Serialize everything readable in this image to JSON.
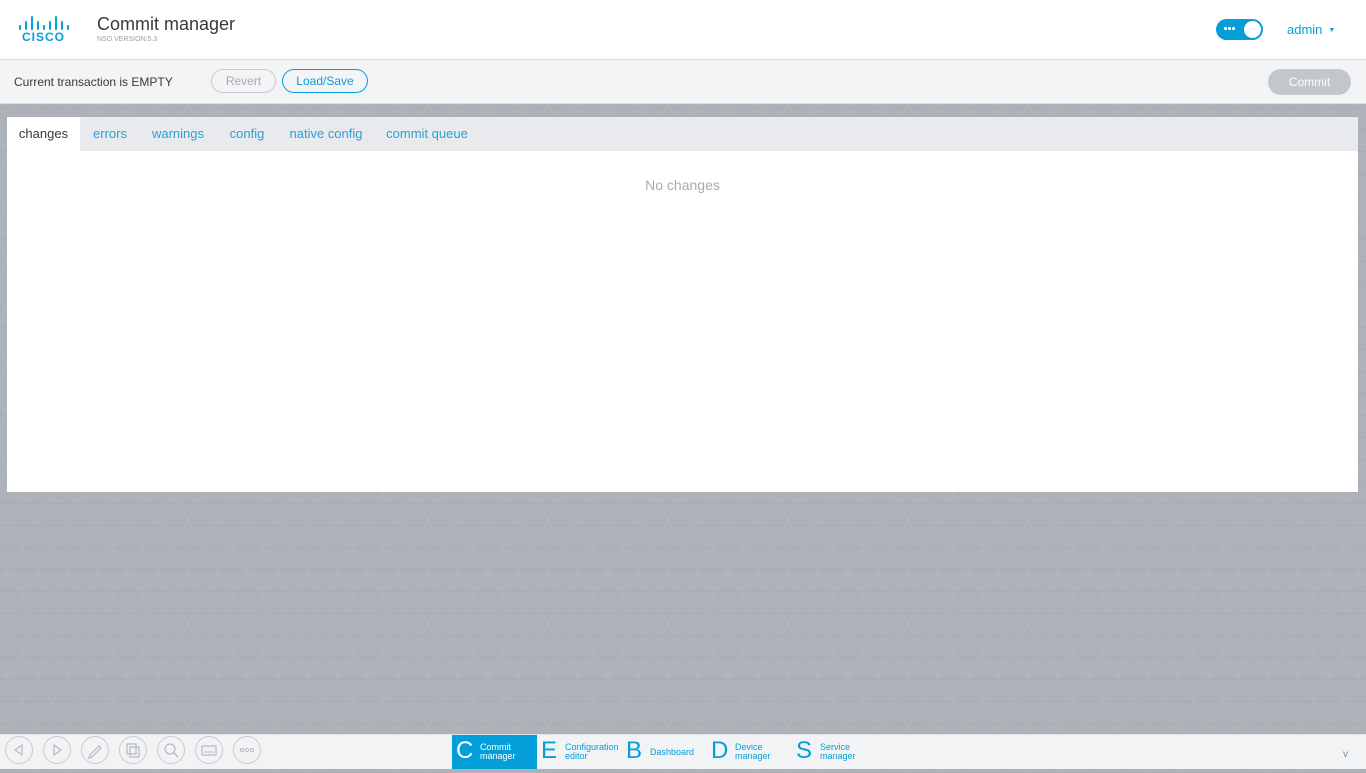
{
  "header": {
    "brand": "CISCO",
    "title": "Commit manager",
    "version": "NSO VERSION:5.3",
    "user": "admin",
    "user_caret": "▼"
  },
  "toolbar": {
    "status": "Current transaction is EMPTY",
    "revert_label": "Revert",
    "load_save_label": "Load/Save",
    "commit_label": "Commit"
  },
  "tabs": [
    {
      "label": "changes",
      "active": true
    },
    {
      "label": "errors"
    },
    {
      "label": "warnings"
    },
    {
      "label": "config"
    },
    {
      "label": "native config"
    },
    {
      "label": "commit queue"
    }
  ],
  "main": {
    "empty_message": "No changes"
  },
  "bottom_bar": {
    "tool_icons": [
      "back-icon",
      "forward-icon",
      "pencil-icon",
      "copy-icon",
      "search-icon",
      "keyboard-icon",
      "more-icon"
    ],
    "apps": [
      {
        "letter": "C",
        "line1": "Commit",
        "line2": "manager",
        "active": true
      },
      {
        "letter": "E",
        "line1": "Configuration",
        "line2": "editor"
      },
      {
        "letter": "B",
        "line1": "Dashboard",
        "line2": ""
      },
      {
        "letter": "D",
        "line1": "Device",
        "line2": "manager"
      },
      {
        "letter": "S",
        "line1": "Service",
        "line2": "manager"
      }
    ],
    "collapse": "v"
  },
  "colors": {
    "accent": "#049fd9",
    "background": "#adb2b8",
    "disabled": "#c3c6ca"
  }
}
